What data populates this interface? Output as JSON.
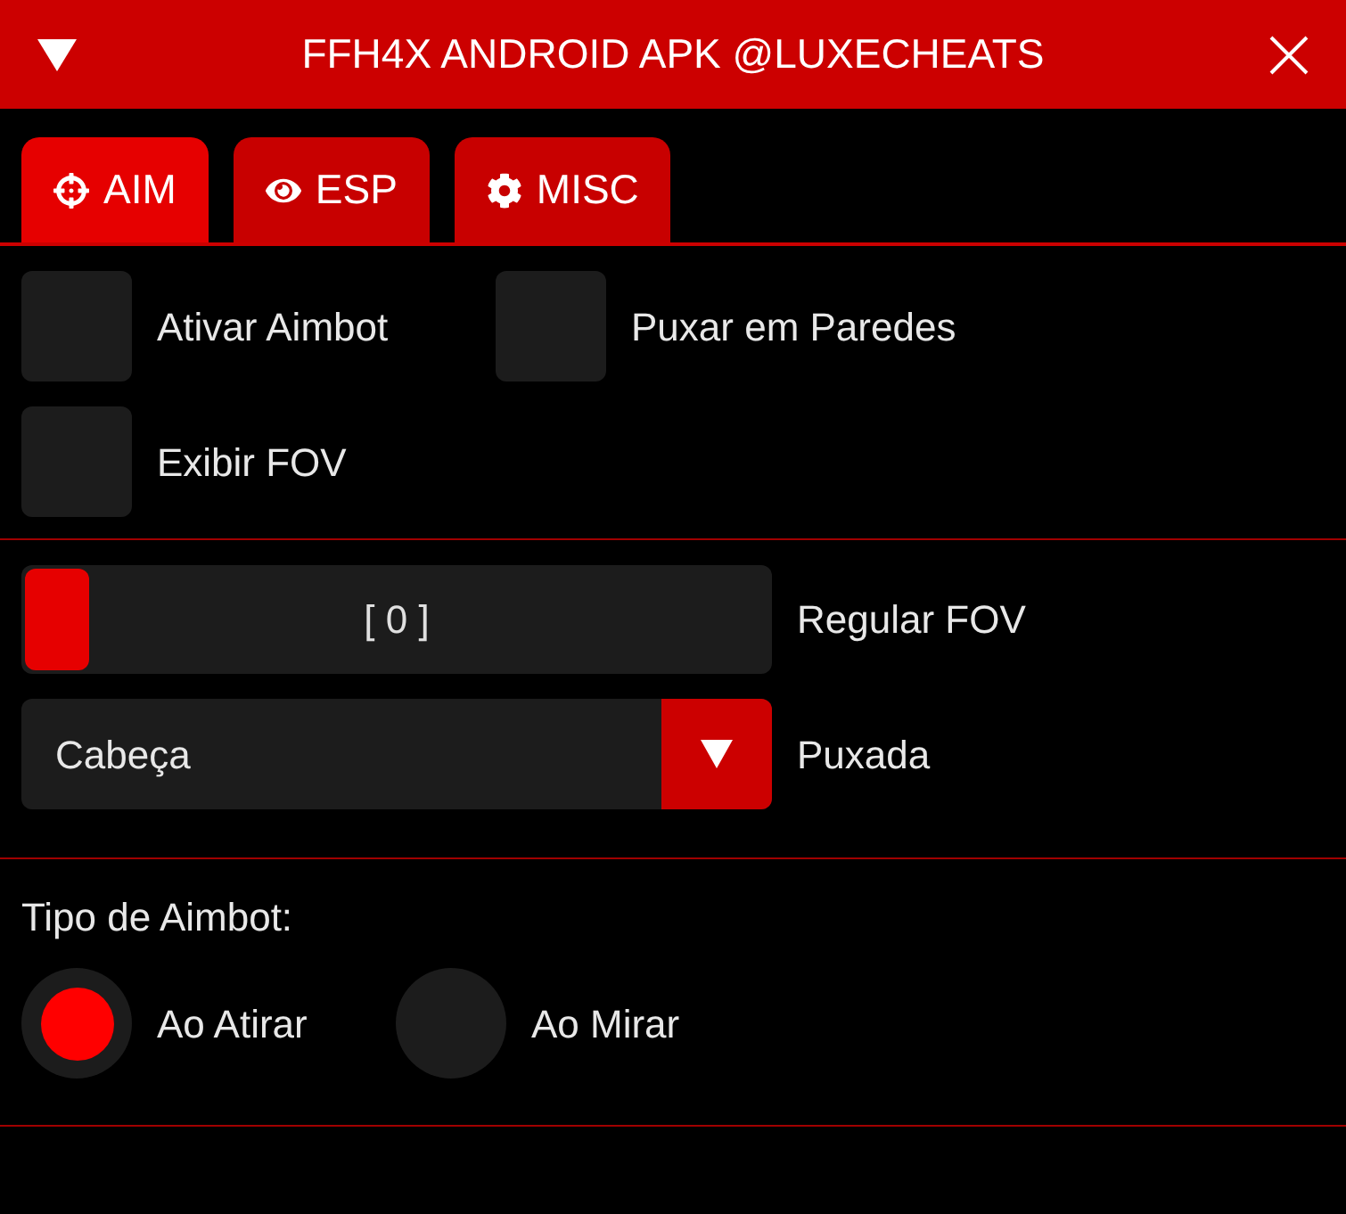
{
  "window": {
    "title": "FFH4X ANDROID APK @LUXECHEATS"
  },
  "tabs": [
    {
      "label": "AIM",
      "selected": true
    },
    {
      "label": "ESP",
      "selected": false
    },
    {
      "label": "MISC",
      "selected": false
    }
  ],
  "toggles": [
    {
      "label": "Ativar Aimbot",
      "checked": false
    },
    {
      "label": "Puxar em Paredes",
      "checked": false
    },
    {
      "label": "Exibir FOV",
      "checked": false
    }
  ],
  "slider": {
    "reading": "[ 0 ]",
    "level": 0,
    "label": "Regular FOV"
  },
  "dropdown": {
    "value": "Cabeça",
    "label": "Puxada"
  },
  "radio_group": {
    "label": "Tipo de Aimbot:",
    "options": [
      {
        "label": "Ao Atirar",
        "selected": true
      },
      {
        "label": "Ao Mirar",
        "selected": false
      }
    ]
  }
}
